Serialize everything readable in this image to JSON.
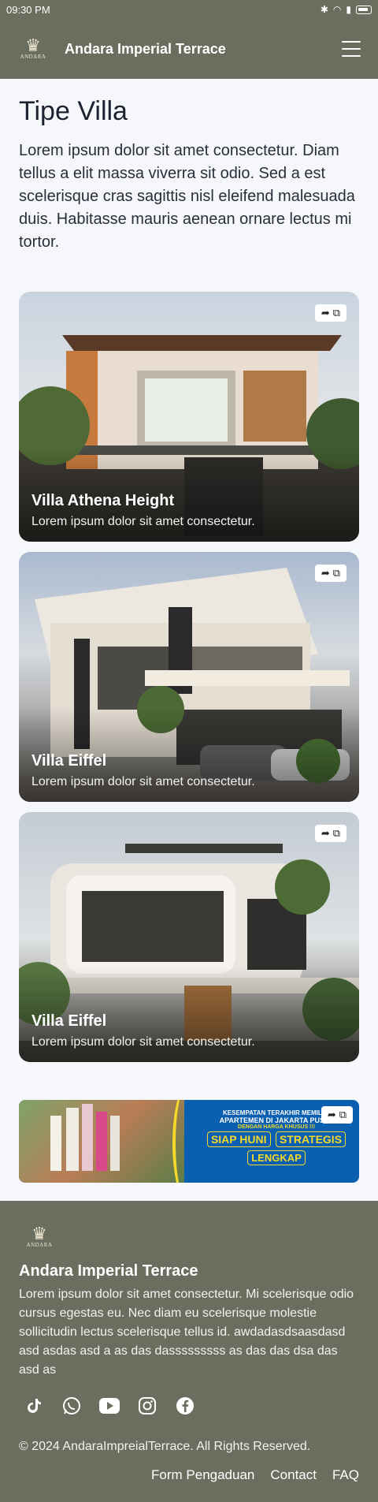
{
  "status_bar": {
    "time": "09:30 PM",
    "signal_label": "5G"
  },
  "app_bar": {
    "logo_text": "ANDARA",
    "title": "Andara Imperial Terrace"
  },
  "page": {
    "title": "Tipe Villa",
    "intro": "Lorem ipsum dolor sit amet consectetur. Diam tellus a elit massa viverra sit odio. Sed a est scelerisque cras sagittis nisl eleifend malesuada duis. Habitasse mauris aenean ornare lectus mi tortor."
  },
  "villas": [
    {
      "name": "Villa Athena Height",
      "description": "Lorem ipsum dolor sit amet consectetur."
    },
    {
      "name": "Villa Eiffel",
      "description": "Lorem ipsum dolor sit amet consectetur."
    },
    {
      "name": "Villa Eiffel",
      "description": "Lorem ipsum dolor sit amet consectetur."
    }
  ],
  "banner": {
    "line1": "KESEMPATAN TERAKHIR MEMILIKI",
    "line2": "APARTEMEN DI JAKARTA PUSAT",
    "line3": "DENGAN HARGA KHUSUS !!!",
    "pill_label1": "Unit Ready",
    "pill1": "SIAP HUNI",
    "pill_label2": "Lokasi",
    "pill2": "STRATEGIS",
    "pill_label3": "Fasilitas",
    "pill3": "LENGKAP"
  },
  "footer": {
    "logo_text": "ANDARA",
    "title": "Andara Imperial Terrace",
    "description": "Lorem ipsum dolor sit amet consectetur. Mi scelerisque odio cursus egestas eu. Nec diam eu scelerisque molestie sollicitudin lectus scelerisque tellus id. awdadasdsaasdasd asd asdas asd a as das dasssssssss as das das dsa das asd as",
    "copyright": "© 2024 AndaraImpreialTerrace. All Rights Reserved.",
    "links": [
      "Form Pengaduan",
      "Contact",
      "FAQ"
    ],
    "socials": [
      "tiktok-icon",
      "whatsapp-icon",
      "youtube-icon",
      "instagram-icon",
      "facebook-icon"
    ]
  },
  "colors": {
    "brand": "#6a6e5f",
    "background": "#f6f7fb",
    "accent_yellow": "#f4d92a",
    "banner_blue": "#0b5fb0"
  }
}
